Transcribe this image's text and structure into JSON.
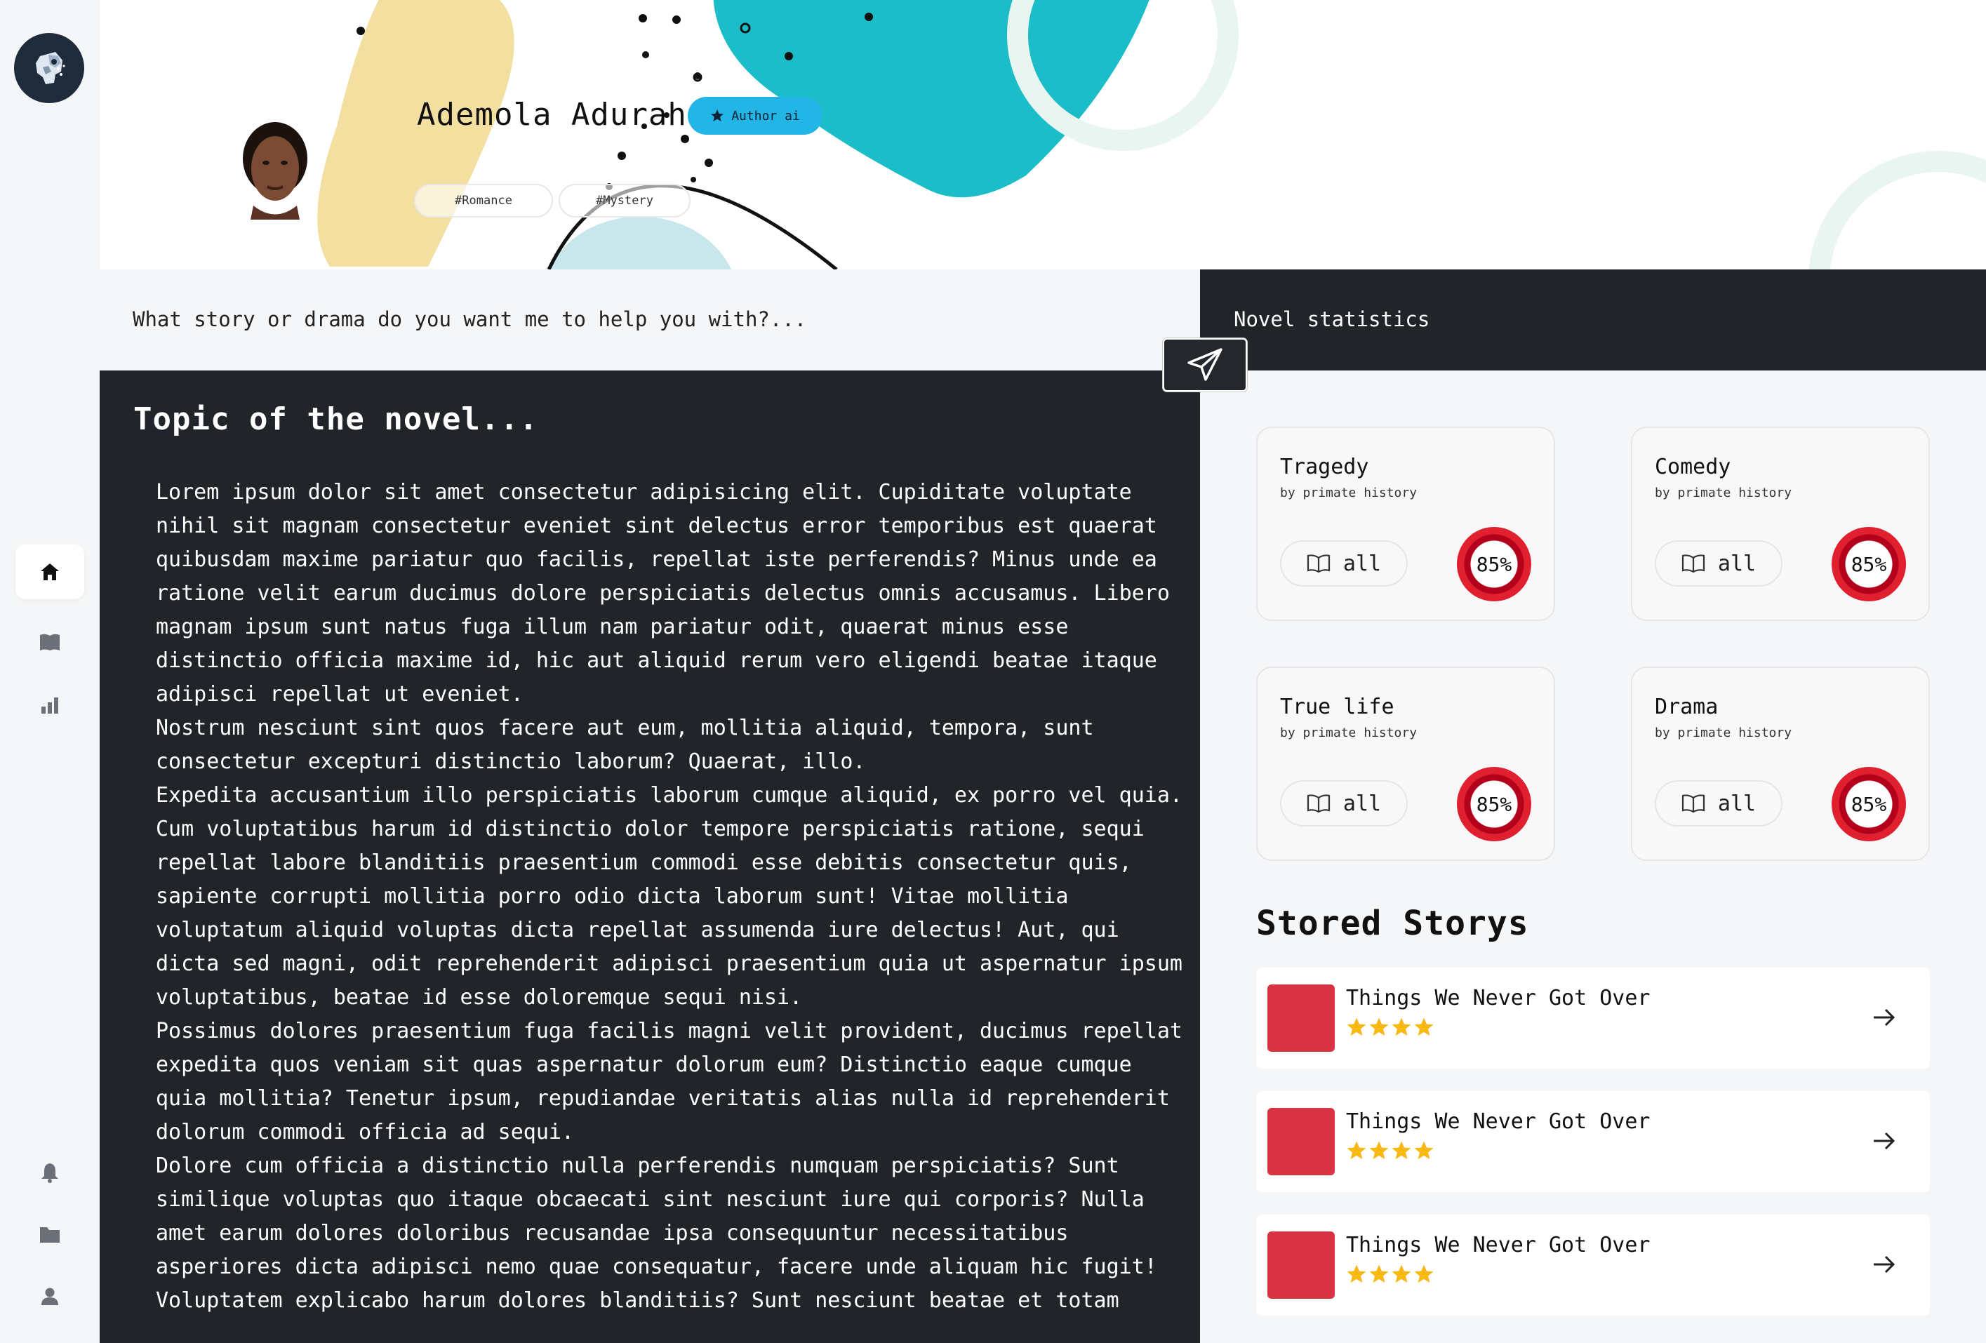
{
  "colors": {
    "sidebar_bg": "#f5f6f7",
    "dark_panel": "#212429",
    "accent_teal": "#1bbdc9",
    "accent_yellow": "#f3e0a1",
    "badge_blue": "#22b5e6",
    "pct_ring": "#e0202f",
    "thumb_red": "#d93343",
    "star_gold": "#f7b915"
  },
  "sidebar": {
    "logo": "robot-head-logo",
    "items": [
      {
        "name": "home",
        "icon": "house-icon",
        "active": true
      },
      {
        "name": "library",
        "icon": "book-icon",
        "active": false
      },
      {
        "name": "stats",
        "icon": "bar-chart-icon",
        "active": false
      }
    ],
    "bottom_items": [
      {
        "name": "notifications",
        "icon": "bell-icon"
      },
      {
        "name": "folders",
        "icon": "folder-icon"
      },
      {
        "name": "profile",
        "icon": "user-icon"
      }
    ]
  },
  "header": {
    "author_name": "Ademola Adurah",
    "badge_label": "Author ai",
    "badge_icon": "star-icon",
    "tags": [
      "#Romance",
      "#Mystery"
    ]
  },
  "prompt": {
    "text": "What story or drama do you want me to help you with?...",
    "send_icon": "send-icon"
  },
  "novel": {
    "title": "Topic of the novel...",
    "paragraphs": [
      "Lorem ipsum dolor sit amet consectetur adipisicing elit. Cupiditate voluptate nihil sit magnam consectetur eveniet sint delectus error temporibus est quaerat quibusdam maxime pariatur quo facilis, repellat iste perferendis? Minus unde ea ratione velit earum ducimus dolore perspiciatis delectus omnis accusamus. Libero magnam ipsum sunt natus fuga illum nam pariatur odit, quaerat minus esse distinctio officia maxime id, hic aut aliquid rerum vero eligendi beatae itaque adipisci repellat ut eveniet.",
      "Nostrum nesciunt sint quos facere aut eum, mollitia aliquid, tempora, sunt consectetur excepturi distinctio laborum? Quaerat, illo.",
      "Expedita accusantium illo perspiciatis laborum cumque aliquid, ex porro vel quia.",
      "Cum voluptatibus harum id distinctio dolor tempore perspiciatis ratione, sequi repellat labore blanditiis praesentium commodi esse debitis consectetur quis, sapiente corrupti mollitia porro odio dicta laborum sunt! Vitae mollitia voluptatum aliquid voluptas dicta repellat assumenda iure delectus! Aut, qui dicta sed magni, odit reprehenderit adipisci praesentium quia ut aspernatur ipsum voluptatibus, beatae id esse doloremque sequi nisi.",
      "Possimus dolores praesentium fuga facilis magni velit provident, ducimus repellat expedita quos veniam sit quas aspernatur dolorum eum? Distinctio eaque cumque quia mollitia? Tenetur ipsum, repudiandae veritatis alias nulla id reprehenderit dolorum commodi officia ad sequi.",
      "Dolore cum officia a distinctio nulla perferendis numquam perspiciatis? Sunt similique voluptas quo itaque obcaecati sint nesciunt iure qui corporis? Nulla amet earum dolores doloribus recusandae ipsa consequuntur necessitatibus asperiores dicta adipisci nemo quae consequatur, facere unde aliquam hic fugit!",
      "Voluptatem explicabo harum dolores blanditiis? Sunt nesciunt beatae et totam"
    ]
  },
  "stats": {
    "title": "Novel statistics",
    "cards": [
      {
        "name": "Tragedy",
        "sub": "by primate history",
        "all_label": "all",
        "all_icon": "open-book-icon",
        "percent_label": "85%",
        "percent": 85
      },
      {
        "name": "Comedy",
        "sub": "by primate history",
        "all_label": "all",
        "all_icon": "open-book-icon",
        "percent_label": "85%",
        "percent": 85
      },
      {
        "name": "True life",
        "sub": "by primate history",
        "all_label": "all",
        "all_icon": "open-book-icon",
        "percent_label": "85%",
        "percent": 85
      },
      {
        "name": "Drama",
        "sub": "by primate history",
        "all_label": "all",
        "all_icon": "open-book-icon",
        "percent_label": "85%",
        "percent": 85
      }
    ]
  },
  "stored": {
    "title": "Stored Storys",
    "items": [
      {
        "name": "Things We Never Got Over",
        "rating": 4,
        "arrow_icon": "arrow-right-icon"
      },
      {
        "name": "Things We Never Got Over",
        "rating": 4,
        "arrow_icon": "arrow-right-icon"
      },
      {
        "name": "Things We Never Got Over",
        "rating": 4,
        "arrow_icon": "arrow-right-icon"
      }
    ]
  }
}
